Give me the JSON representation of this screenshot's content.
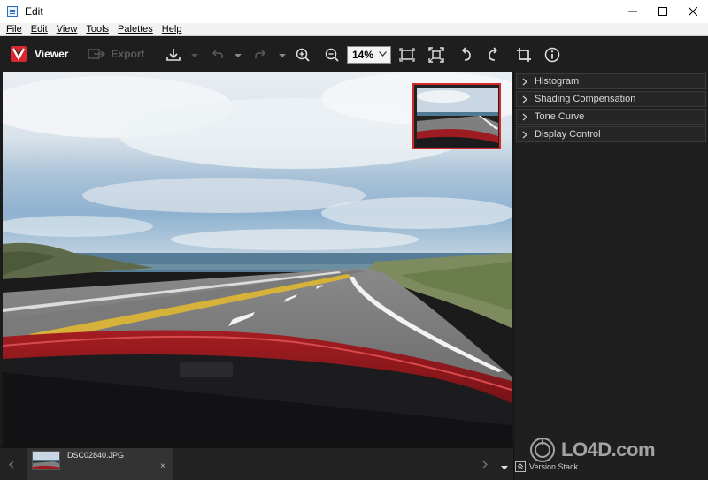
{
  "window": {
    "title": "Edit"
  },
  "menu": [
    "File",
    "Edit",
    "View",
    "Tools",
    "Palettes",
    "Help"
  ],
  "toolbar": {
    "viewer_label": "Viewer",
    "export_label": "Export",
    "zoom_value": "14%",
    "icons": [
      "download-icon",
      "undo-icon",
      "redo-icon",
      "zoom-in-icon",
      "zoom-out-icon",
      "fit-screen-icon",
      "full-screen-icon",
      "rotate-left-icon",
      "rotate-right-icon",
      "crop-icon",
      "info-icon"
    ]
  },
  "palettes": [
    "Histogram",
    "Shading Compensation",
    "Tone Curve",
    "Display Control"
  ],
  "filmstrip": {
    "file_name": "DSC02840.JPG",
    "close_glyph": "×"
  },
  "version_stack_label": "Version Stack",
  "watermark": "LO4D.com",
  "colors": {
    "accent": "#d7282f",
    "panel": "#1f1f1f",
    "toolbar": "#1e1e1e",
    "navigator_border": "#d32b2b"
  }
}
